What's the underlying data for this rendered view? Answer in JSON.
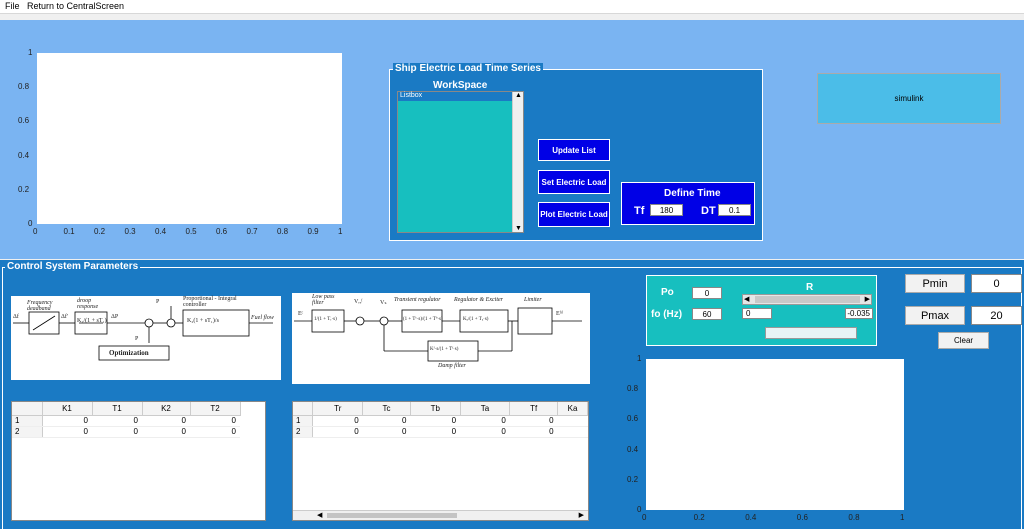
{
  "menu": {
    "file": "File",
    "return": "Return to CentralScreen"
  },
  "top_plot": {
    "x_ticks": [
      "0",
      "0.1",
      "0.2",
      "0.3",
      "0.4",
      "0.5",
      "0.6",
      "0.7",
      "0.8",
      "0.9",
      "1"
    ],
    "y_ticks": [
      "0",
      "0.2",
      "0.4",
      "0.6",
      "0.8",
      "1"
    ]
  },
  "load_panel": {
    "title": "Ship Electric Load Time Series",
    "workspace_label": "WorkSpace",
    "listbox_item": "Listbox",
    "update_btn": "Update List",
    "set_btn": "Set  Electric Load",
    "plot_btn": "Plot  Electric Load",
    "define_time": {
      "title": "Define Time",
      "tf_label": "Tf",
      "tf_value": "180",
      "dt_label": "DT",
      "dt_value": "0.1"
    }
  },
  "simulink_btn": "simulink",
  "control_panel": {
    "title": "Control System Parameters"
  },
  "diagram_left": {
    "freq_deadband": "Frequency deadband",
    "droop": "droop response",
    "pi_ctrl": "Proportional - Integral controller",
    "pi_block": "K₂(1 + sT₁)/s",
    "droop_block": "K₁/(1 + sT₁)",
    "in_label": "Δf",
    "mid_label": "Δf'",
    "out_label": "Fuel flow",
    "optimization": "Optimization",
    "p_demand": "P",
    "p_ref": "P",
    "delta_p": "ΔP"
  },
  "diagram_right": {
    "lowpass": "Low pass filter",
    "lowpass_block": "1/(1 + Tᵣ·s)",
    "transient": "Transient regulator",
    "trans_block": "(1 + Tᶜ·s)/(1 + Tᵇ·s)",
    "reg_exc": "Regulator & Exciter",
    "reg_block": "Kₐ/(1 + Tₐ·s)",
    "limiter": "Limiter",
    "damp_block": "Kᶠ·s/(1 + Tᶠ·s)",
    "damp_filter": "Damp filter",
    "ec": "Eᶜ",
    "efd": "Eᶠᵈ",
    "vref": "Vᵣₑᶠ",
    "vs": "Vₛ"
  },
  "table_left": {
    "headers": [
      "",
      "K1",
      "T1",
      "K2",
      "T2"
    ],
    "rows": [
      [
        "1",
        "0",
        "0",
        "0",
        "0"
      ],
      [
        "2",
        "0",
        "0",
        "0",
        "0"
      ]
    ]
  },
  "table_right": {
    "headers": [
      "",
      "Tr",
      "Tc",
      "Tb",
      "Ta",
      "Tf",
      "Ka"
    ],
    "rows": [
      [
        "1",
        "0",
        "0",
        "0",
        "0",
        "0",
        ""
      ],
      [
        "2",
        "0",
        "0",
        "0",
        "0",
        "0",
        ""
      ]
    ]
  },
  "r_panel": {
    "po_label": "Po",
    "po_value": "0",
    "fo_label": "fo (Hz)",
    "fo_value": "60",
    "r_title": "R",
    "r_min": "0",
    "r_val": "-0.035"
  },
  "pmin": {
    "label": "Pmin",
    "value": "0"
  },
  "pmax": {
    "label": "Pmax",
    "value": "20"
  },
  "clear_btn": "Clear",
  "bottom_plot": {
    "x_ticks": [
      "0",
      "0.2",
      "0.4",
      "0.6",
      "0.8",
      "1"
    ],
    "y_ticks": [
      "0",
      "0.2",
      "0.4",
      "0.6",
      "0.8",
      "1"
    ]
  }
}
